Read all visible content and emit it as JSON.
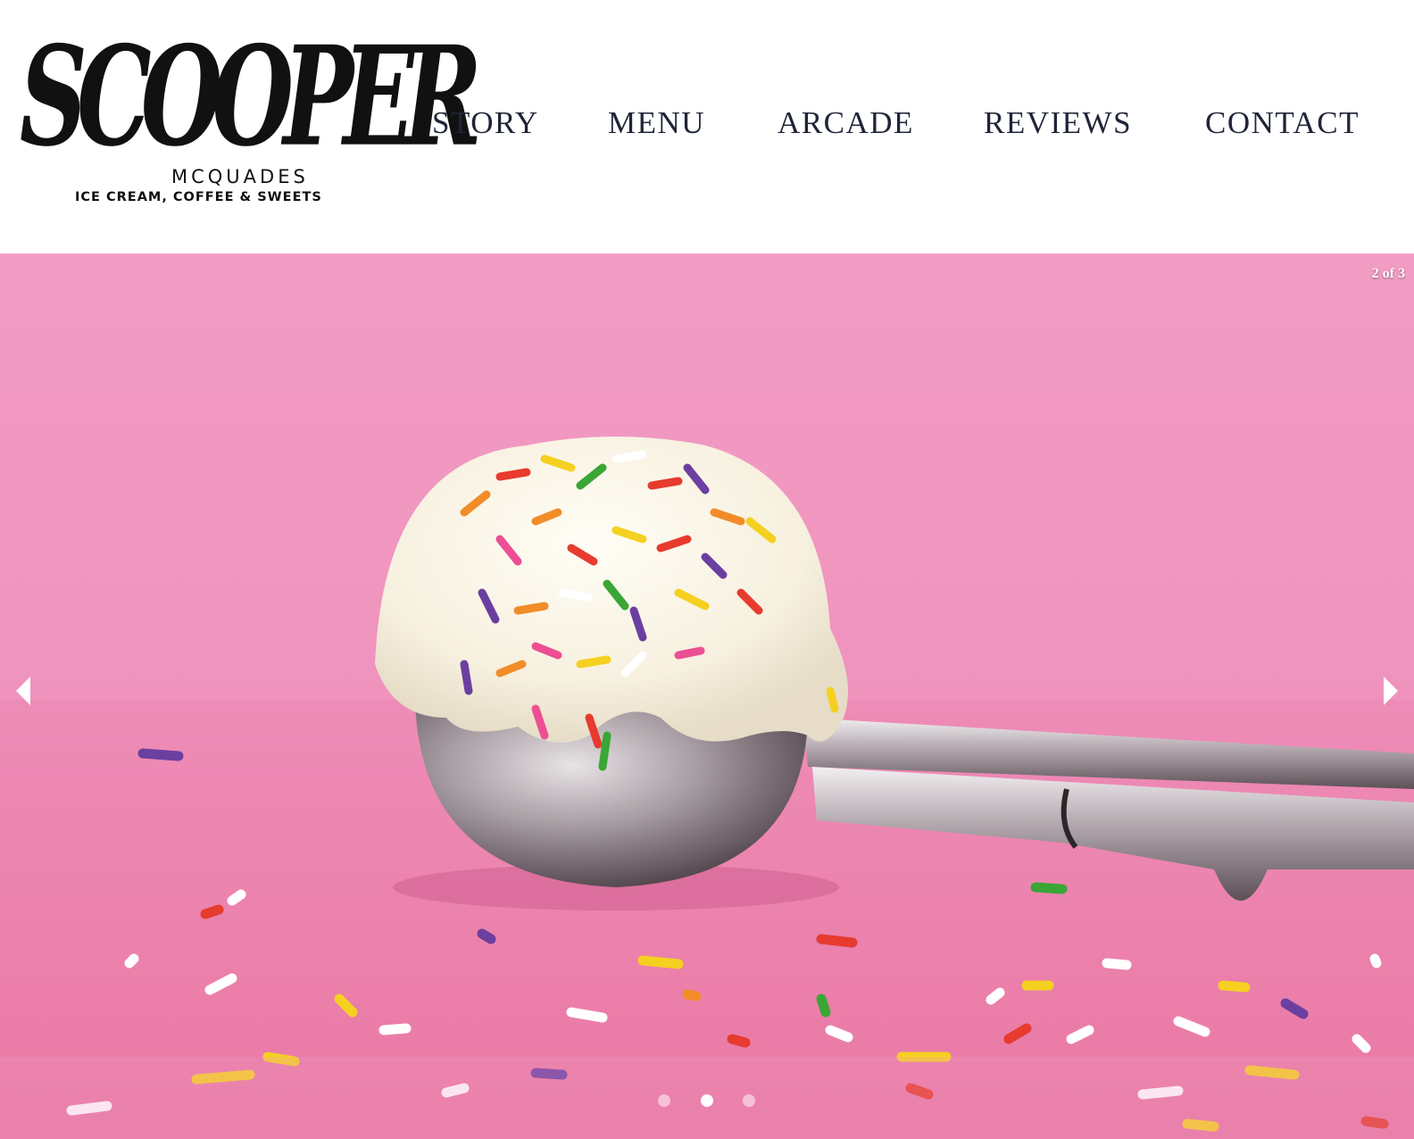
{
  "brand": {
    "name": "Scooper",
    "sub": "MCQUADES",
    "tagline": "ICE CREAM, COFFEE & SWEETS"
  },
  "nav": {
    "items": [
      {
        "label": "STORY"
      },
      {
        "label": "MENU"
      },
      {
        "label": "ARCADE"
      },
      {
        "label": "REVIEWS"
      },
      {
        "label": "CONTACT"
      }
    ]
  },
  "slideshow": {
    "counter": "2 of 3",
    "current": 2,
    "total": 3,
    "image": "ice cream scoop with rainbow sprinkles on pink background",
    "prev_icon": "triangle-left-icon",
    "next_icon": "triangle-right-icon"
  },
  "colors": {
    "nav_text": "#1f2537",
    "hero_bg": "#ef8db8",
    "dot_active": "#ffffff",
    "dot_inactive": "#f6c1d8"
  }
}
